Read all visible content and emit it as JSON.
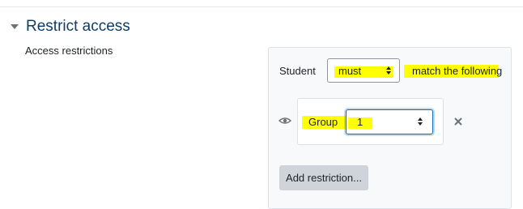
{
  "section": {
    "title": "Restrict access",
    "collapse_icon": "caret-down-icon"
  },
  "field": {
    "label": "Access restrictions"
  },
  "restriction": {
    "student_label": "Student",
    "must_select_value": "must",
    "match_text": "match the following",
    "condition": {
      "visibility_icon": "eye-icon",
      "type_label": "Group",
      "group_select_value": "1",
      "delete_icon": "close-icon"
    },
    "add_button_label": "Add restriction..."
  },
  "colors": {
    "highlight": "#ffff00",
    "title": "#0f3d66",
    "focus_border": "#0f6cbf"
  }
}
